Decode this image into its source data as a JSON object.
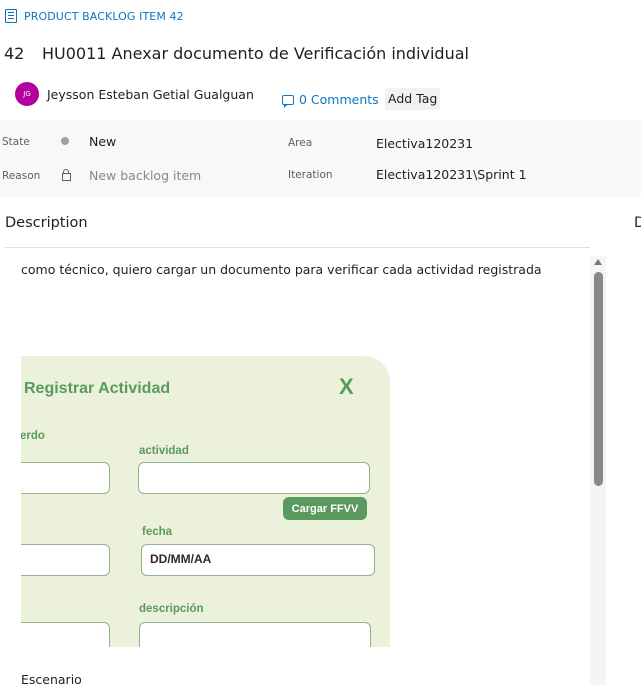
{
  "header": {
    "type_label": "PRODUCT BACKLOG ITEM 42",
    "item_id": "42",
    "title": "HU0011 Anexar documento de Verificación individual",
    "avatar_initials": "JG",
    "assignee": "Jeysson Esteban Getial Gualguan",
    "comments": "0 Comments",
    "add_tag": "Add Tag",
    "avatar_color": "#b4009e",
    "accent_color": "#0a76c2"
  },
  "fields": {
    "state_label": "State",
    "state_value": "New",
    "reason_label": "Reason",
    "reason_value": "New backlog item",
    "area_label": "Area",
    "area_value": "Electiva120231",
    "iteration_label": "Iteration",
    "iteration_value": "Electiva120231\\Sprint 1"
  },
  "description": {
    "title": "Description",
    "right_column_partial": "D",
    "text": "como técnico, quiero cargar un documento para verificar cada actividad registrada",
    "after_image_text": "Escenario"
  },
  "mockup": {
    "title": "Registrar Actividad",
    "close": "X",
    "label_acuerdo": "uerdo",
    "label_actividad": "actividad",
    "button": "Cargar FFVV",
    "label_fecha": "fecha",
    "date_placeholder": "DD/MM/AA",
    "label_descripcion": "descripción",
    "bg_color": "#ebf1da",
    "accent_color": "#5b9a5f"
  },
  "icons": {
    "type": "backlog-item-icon",
    "comments": "comment-icon",
    "state": "state-dot-icon",
    "reason": "lock-icon"
  }
}
